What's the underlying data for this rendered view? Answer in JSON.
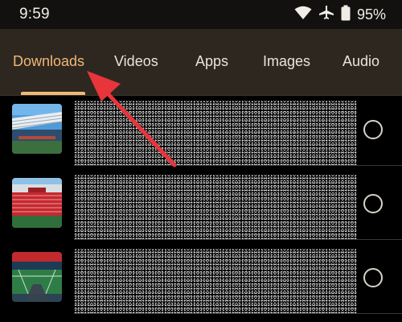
{
  "status_bar": {
    "time": "9:59",
    "battery": "95%",
    "icons": [
      "wifi-icon",
      "airplane-icon",
      "battery-icon"
    ]
  },
  "tabs": [
    {
      "label": "Downloads",
      "active": true
    },
    {
      "label": "Videos",
      "active": false
    },
    {
      "label": "Apps",
      "active": false
    },
    {
      "label": "Images",
      "active": false
    },
    {
      "label": "Audio",
      "active": false
    }
  ],
  "list": {
    "items": [
      {
        "thumbnail": "stadium-roof-photo",
        "selected": false
      },
      {
        "thumbnail": "stadium-stands-photo",
        "selected": false
      },
      {
        "thumbnail": "stadium-pitch-photo",
        "selected": false
      }
    ]
  },
  "colors": {
    "accent": "#f0b877",
    "tab_bar_bg": "#2d271f",
    "annotation_arrow": "#e8343b"
  }
}
